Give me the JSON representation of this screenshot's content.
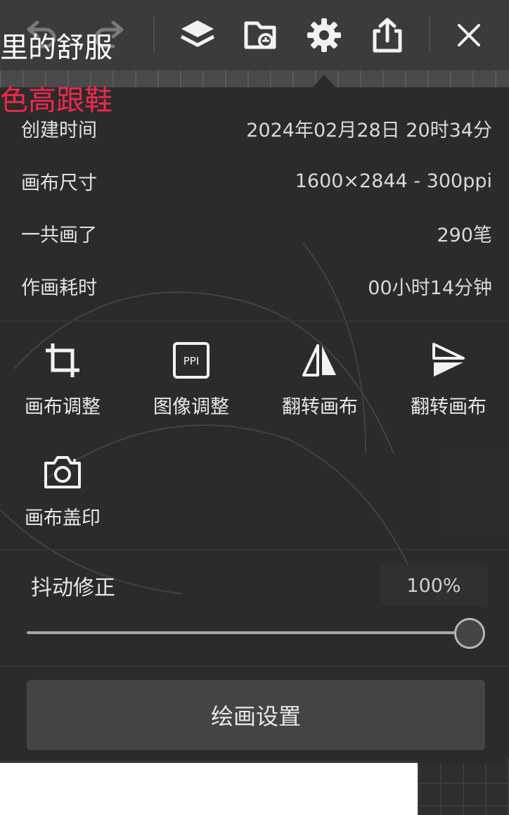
{
  "background": {
    "title_fragment": "里的舒服",
    "subtitle_fragment": "色高跟鞋"
  },
  "toolbar": {
    "icons": [
      "undo-icon",
      "redo-icon",
      "layers-icon",
      "gallery-icon",
      "settings-gear-icon",
      "share-icon",
      "close-icon"
    ]
  },
  "info": {
    "created_label": "创建时间",
    "created_value": "2024年02月28日 20时34分",
    "canvas_size_label": "画布尺寸",
    "canvas_size_value": "1600×2844 - 300ppi",
    "strokes_label": "一共画了",
    "strokes_value": "290笔",
    "time_label": "作画耗时",
    "time_value": "00小时14分钟"
  },
  "tools": [
    {
      "label": "画布调整",
      "icon": "crop-icon"
    },
    {
      "label": "图像调整",
      "icon": "ppi-icon",
      "icon_text": "PPI"
    },
    {
      "label": "翻转画布",
      "icon": "flip-horizontal-icon"
    },
    {
      "label": "翻转画布",
      "icon": "flip-vertical-icon"
    },
    {
      "label": "画布盖印",
      "icon": "camera-icon"
    }
  ],
  "stabilizer": {
    "label": "抖动修正",
    "value": "100%",
    "level": 1.0
  },
  "footer": {
    "button_label": "绘画设置"
  },
  "colors": {
    "panel_bg": "#2b2b2b",
    "accent_red": "#f0284a"
  }
}
